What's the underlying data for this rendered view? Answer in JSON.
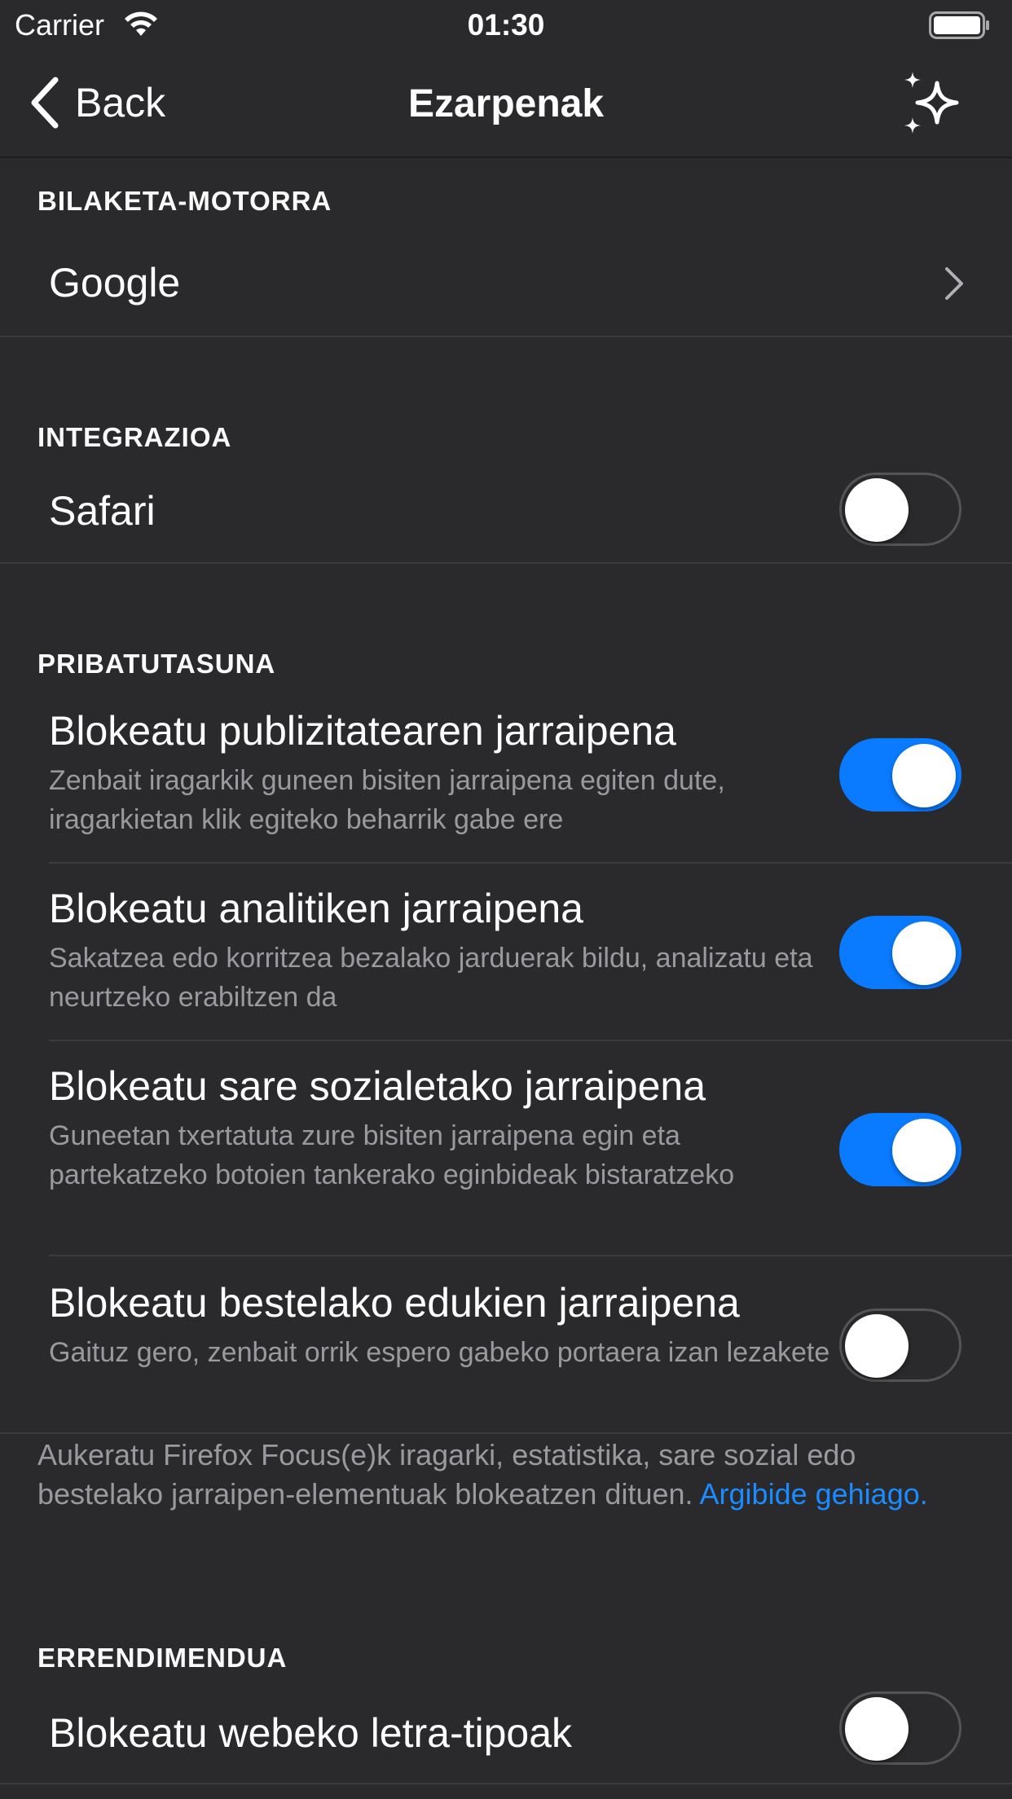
{
  "status_bar": {
    "carrier": "Carrier",
    "time": "01:30"
  },
  "nav": {
    "back_label": "Back",
    "title": "Ezarpenak",
    "whats_new_icon": "sparkle-icon"
  },
  "search_engine": {
    "header": "BILAKETA-MOTORRA",
    "value": "Google"
  },
  "integration": {
    "header": "INTEGRAZIOA",
    "safari_label": "Safari",
    "safari_enabled": false
  },
  "privacy": {
    "header": "PRIBATUTASUNA",
    "items": [
      {
        "title": "Blokeatu publizitatearen jarraipena",
        "subtitle": "Zenbait iragarkik guneen bisiten jarraipena egiten dute, iragarkietan klik egiteko beharrik gabe ere",
        "enabled": true
      },
      {
        "title": "Blokeatu analitiken jarraipena",
        "subtitle": "Sakatzea edo korritzea bezalako jarduerak bildu, analizatu eta neurtzeko erabiltzen da",
        "enabled": true
      },
      {
        "title": "Blokeatu sare sozialetako jarraipena",
        "subtitle": "Guneetan txertatuta zure bisiten jarraipena egin eta partekatzeko botoien tankerako eginbideak bistaratzeko",
        "enabled": true
      },
      {
        "title": "Blokeatu bestelako edukien jarraipena",
        "subtitle": "Gaituz gero, zenbait orrik espero gabeko portaera izan lezakete",
        "enabled": false
      }
    ],
    "footer_text": "Aukeratu Firefox Focus(e)k iragarki, estatistika, sare sozial edo bestelako jarraipen-elementuak blokeatzen dituen. ",
    "footer_link": "Argibide gehiago."
  },
  "performance": {
    "header": "ERRENDIMENDUA",
    "fonts_label": "Blokeatu webeko letra-tipoak",
    "fonts_enabled": false
  },
  "colors": {
    "background": "#2a2a2c",
    "toggle_on": "#0a7aff",
    "link": "#1a8cff",
    "secondary_text": "#9a9a9e"
  }
}
